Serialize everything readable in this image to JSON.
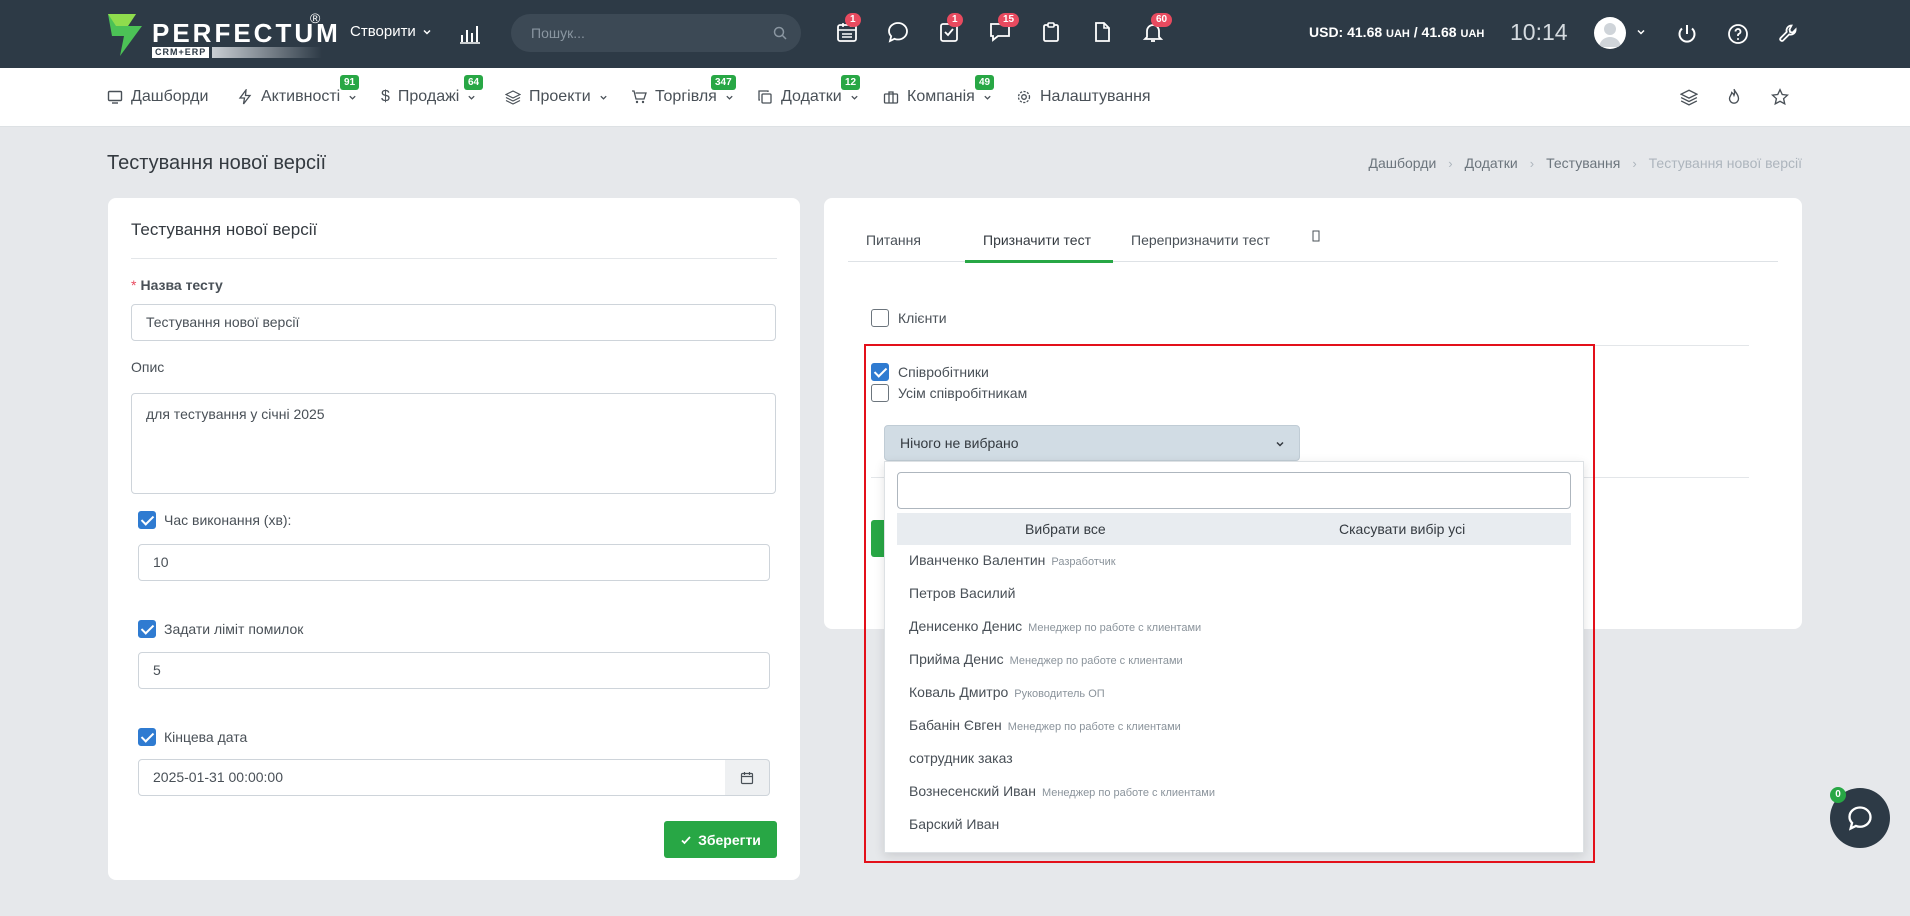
{
  "topbar": {
    "logo_text": "PERFECTUM",
    "logo_sub": "CRM+ERP",
    "logo_reg": "®",
    "create_label": "Створити",
    "search_placeholder": "Пошук...",
    "badges": {
      "calendar": "1",
      "tasks": "1",
      "messages": "15",
      "notifications": "60"
    },
    "usd_label": "USD: 41.68",
    "usd_unit1": "UAH",
    "usd_sep": "/ 41.68",
    "usd_unit2": "UAH",
    "time": "10:14"
  },
  "menu": {
    "items": [
      {
        "label": "Дашборди"
      },
      {
        "label": "Активності",
        "badge": "91"
      },
      {
        "label": "Продажі",
        "badge": "64"
      },
      {
        "label": "Проекти"
      },
      {
        "label": "Торгівля",
        "badge": "347"
      },
      {
        "label": "Додатки",
        "badge": "12"
      },
      {
        "label": "Компанія",
        "badge": "49"
      },
      {
        "label": "Налаштування"
      }
    ]
  },
  "page": {
    "title": "Тестування нової версії",
    "breadcrumb": [
      "Дашборди",
      "Додатки",
      "Тестування",
      "Тестування нової версії"
    ]
  },
  "form": {
    "card_title": "Тестування нової версії",
    "name_label": "Назва тесту",
    "name_required": "*",
    "name_value": "Тестування нової версії",
    "desc_label": "Опис",
    "desc_value": "для тестування у січні 2025",
    "time_label": "Час виконання (хв):",
    "time_checked": true,
    "time_value": "10",
    "errors_label": "Задати ліміт помилок",
    "errors_checked": true,
    "errors_value": "5",
    "end_label": "Кінцева дата",
    "end_checked": true,
    "end_value": "2025-01-31 00:00:00",
    "save_label": "Зберегти"
  },
  "assign": {
    "tabs": [
      "Питання",
      "Призначити тест",
      "Перепризначити тест",
      ""
    ],
    "active_tab": "Призначити тест",
    "clients_label": "Клієнти",
    "clients_checked": false,
    "employees_label": "Співробітники",
    "employees_checked": true,
    "all_employees_label": "Усім співробітникам",
    "all_employees_checked": false,
    "select_value": "Нічого не вибрано",
    "select_all": "Вибрати все",
    "deselect_all": "Скасувати вибір усі",
    "options": [
      {
        "name": "Иванченко Валентин",
        "role": "Разработчик"
      },
      {
        "name": "Петров Василий",
        "role": ""
      },
      {
        "name": "Денисенко Денис",
        "role": "Менеджер по работе с клиентами"
      },
      {
        "name": "Прийма Денис",
        "role": "Менеджер по работе с клиентами"
      },
      {
        "name": "Коваль Дмитро",
        "role": "Руководитель ОП"
      },
      {
        "name": "Бабанін Євген",
        "role": "Менеджер по работе с клиентами"
      },
      {
        "name": "сотрудник заказ",
        "role": ""
      },
      {
        "name": "Вознесенский Иван",
        "role": "Менеджер по работе с клиентами"
      },
      {
        "name": "Барский Иван",
        "role": ""
      }
    ]
  },
  "chat": {
    "badge": "0"
  },
  "colors": {
    "topbar": "#2d3a46",
    "accent_green": "#28a745",
    "badge_red": "#e84a5f",
    "highlight_red": "#e3101a",
    "checkbox_blue": "#2f7bd1"
  }
}
